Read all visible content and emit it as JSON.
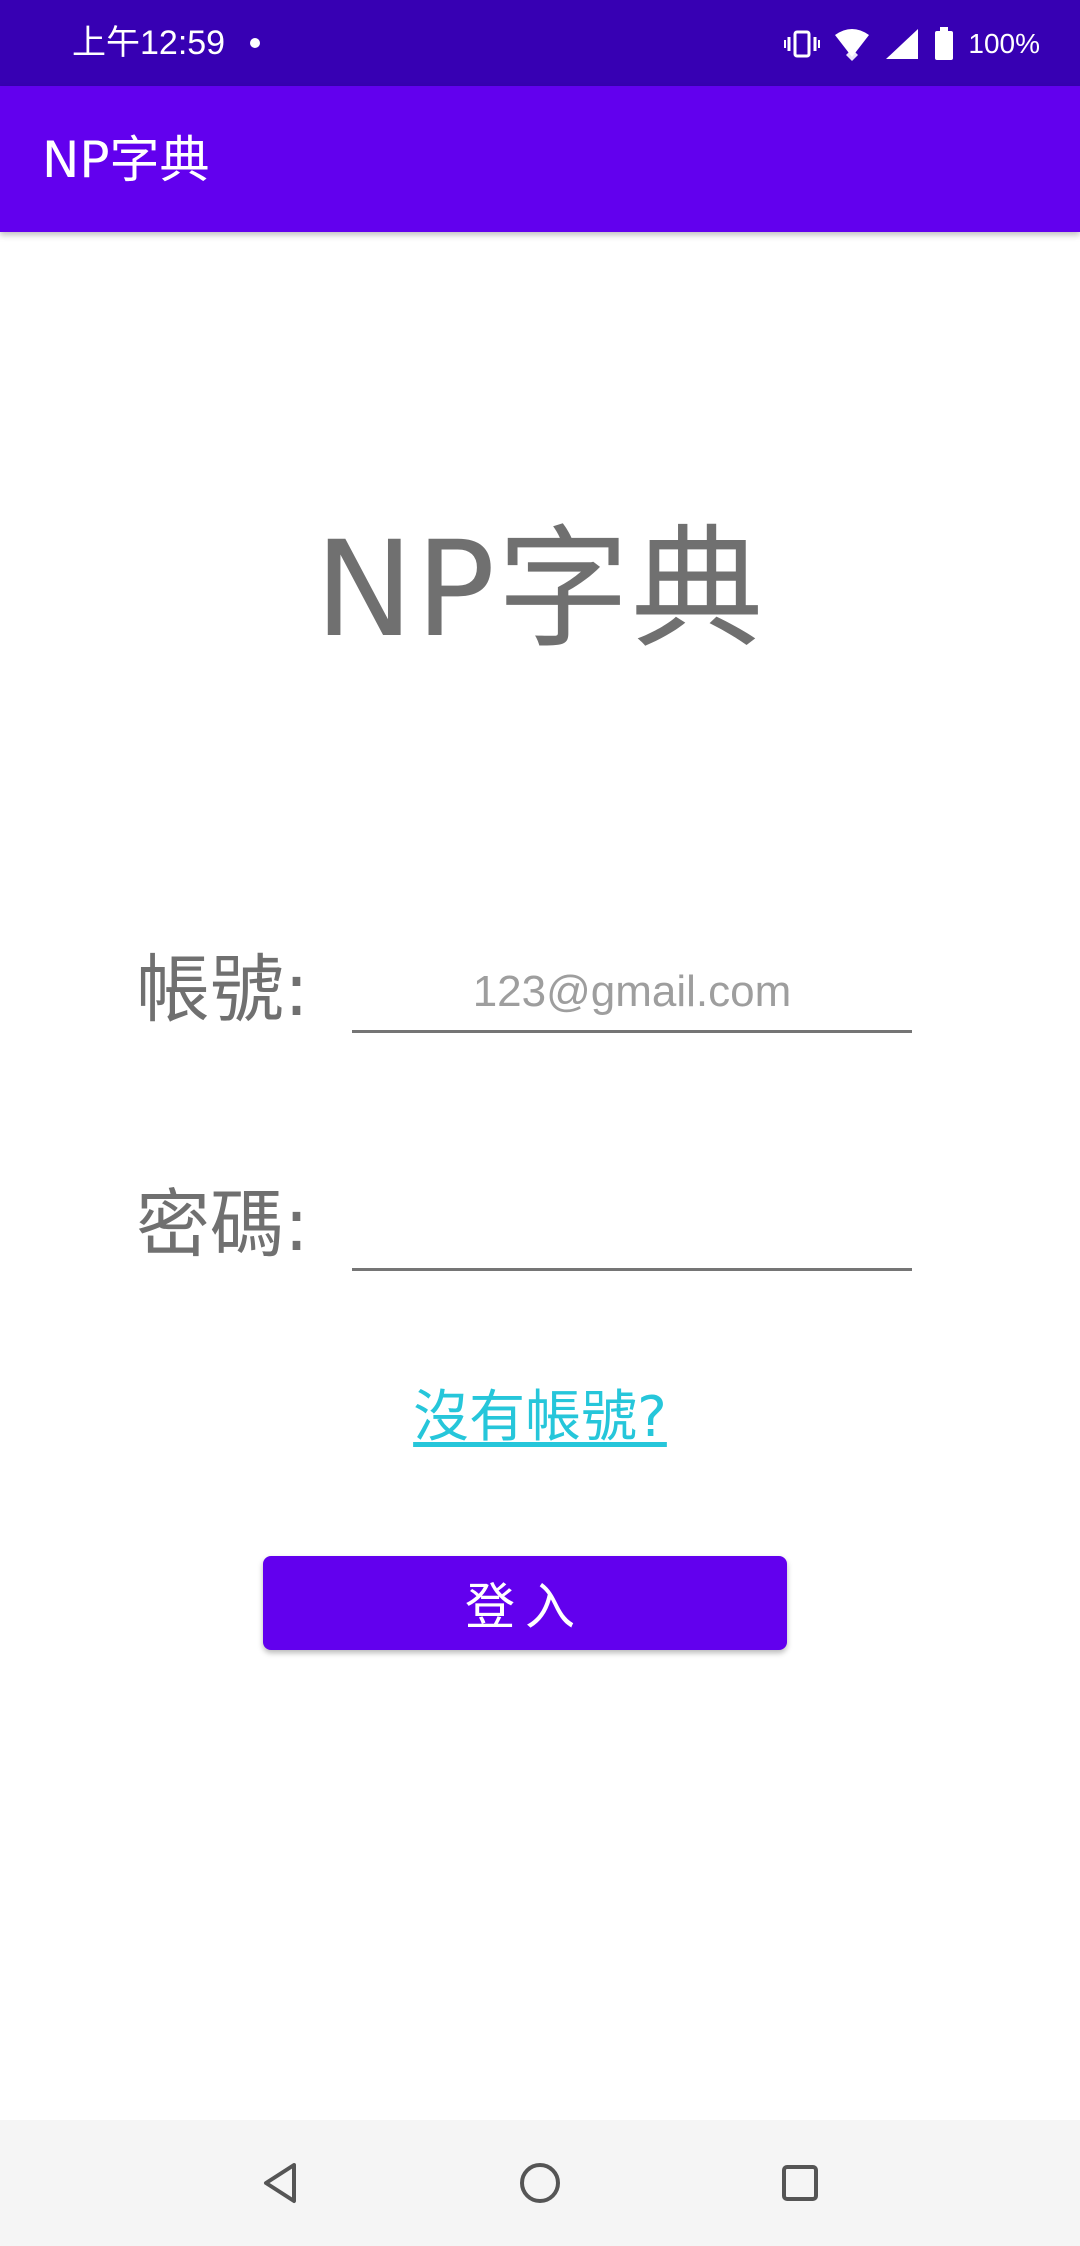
{
  "status_bar": {
    "time": "上午12:59",
    "battery": "100%",
    "icons": [
      "vibrate-icon",
      "wifi-icon",
      "cell-signal-icon",
      "battery-icon"
    ]
  },
  "app_bar": {
    "title": "NP字典",
    "color": "#6200ee"
  },
  "login": {
    "title": "NP字典",
    "account_label": "帳號:",
    "account_placeholder": "123@gmail.com",
    "password_label": "密碼:",
    "password_placeholder": "",
    "no_account_link": "沒有帳號?",
    "login_button": "登入"
  },
  "nav_bar": {
    "icons": [
      "back-icon",
      "home-icon",
      "recents-icon"
    ]
  },
  "colors": {
    "status_bar": "#3700b3",
    "primary": "#6200ee",
    "link": "#26c6da",
    "label": "#707070"
  }
}
